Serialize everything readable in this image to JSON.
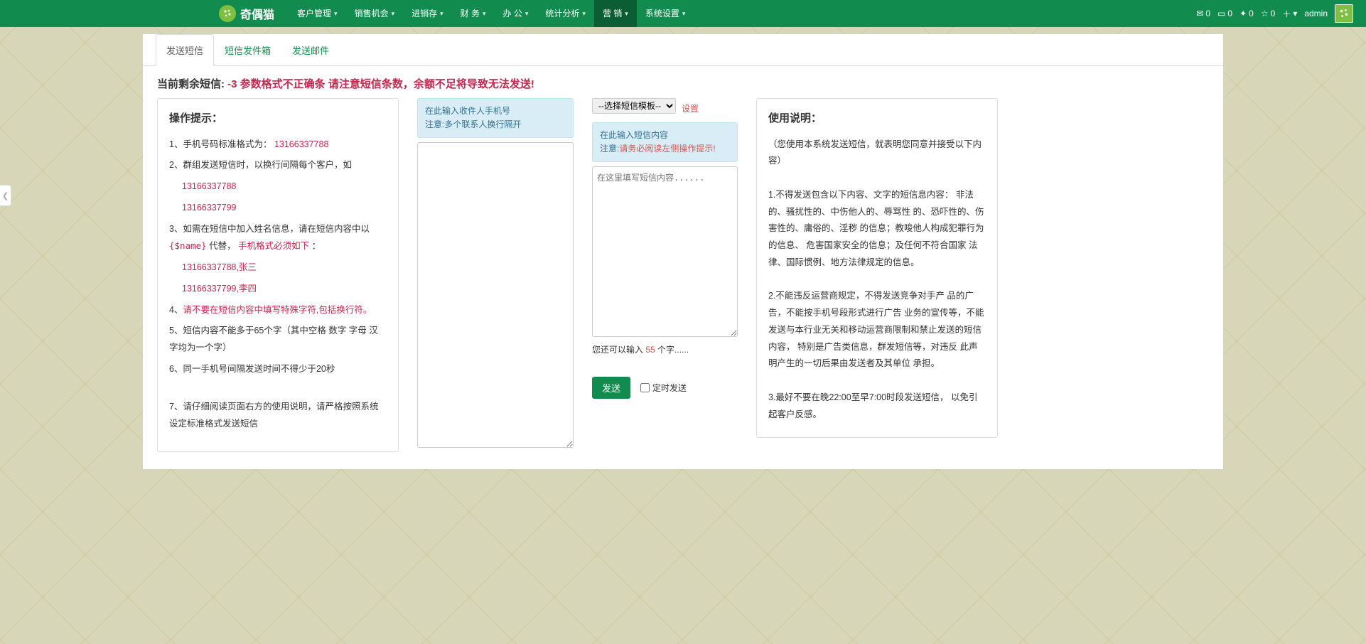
{
  "brand": {
    "name": "奇偶猫"
  },
  "nav": {
    "items": [
      {
        "label": "客户管理"
      },
      {
        "label": "销售机会"
      },
      {
        "label": "进销存"
      },
      {
        "label": "财 务"
      },
      {
        "label": "办 公"
      },
      {
        "label": "统计分析"
      },
      {
        "label": "营 销",
        "active": true
      },
      {
        "label": "系统设置"
      }
    ]
  },
  "navright": {
    "mail_count": "0",
    "card_count": "0",
    "gear_count": "0",
    "star_count": "0",
    "username": "admin"
  },
  "tabs": {
    "t1": "发送短信",
    "t2": "短信发件箱",
    "t3": "发送邮件"
  },
  "alert": {
    "prefix": "当前剩余短信:",
    "red": " -3 参数格式不正确条 请注意短信条数，余额不足将导致无法发送!"
  },
  "tips": {
    "title": "操作提示：",
    "l1a": "1、手机号码标准格式为：  ",
    "l1b": "13166337788",
    "l2": "2、群组发送短信时，以换行间隔每个客户，如",
    "ex1": "13166337788",
    "ex2": "13166337799",
    "l3a": "3、如需在短信中加入姓名信息，请在短信内容中以 ",
    "l3code": "{$name}",
    "l3b": "代替，",
    "l3c": "手机格式必须如下",
    "l3d": " ：",
    "ex3": "13166337788,张三",
    "ex4": "13166337799,李四",
    "l4": "4、",
    "l4red": "请不要在短信内容中填写特殊字符,包括换行符。",
    "l5": "5、短信内容不能多于65个字（其中空格  数字  字母  汉字均为一个字）",
    "l6": "6、同一手机号间隔发送时间不得少于20秒",
    "l7": "7、请仔细阅读页面右方的使用说明，请严格按照系统设定标准格式发送短信"
  },
  "phonehint": {
    "line1": "在此输入收件人手机号",
    "line2": "注意:多个联系人换行隔开"
  },
  "tpl": {
    "selected": "--选择短信模板--",
    "set": "设置"
  },
  "contenthint": {
    "line1": "在此输入短信内容",
    "line2a": "注意:",
    "line2b": "请务必阅读左侧操作提示!"
  },
  "content_placeholder": "在这里填写短信内容......",
  "count": {
    "prefix": "您还可以输入 ",
    "num": "55",
    "suffix": " 个字......"
  },
  "send_btn": "发送",
  "timed_label": "定时发送",
  "usage": {
    "title": "使用说明：",
    "intro": "（您使用本系统发送短信，就表明您同意并接受以下内容）",
    "p1": "1.不得发送包含以下内容、文字的短信息内容：  非法的、骚扰性的、中伤他人的、辱骂性  的、恐吓性的、伤害性的、庸俗的、淫秽  的信息；教唆他人构成犯罪行为的信息、 危害国家安全的信息；及任何不符合国家 法律、国际惯例、地方法律规定的信息。",
    "p2": "2.不能违反运营商规定，不得发送竞争对手产  品的广告，不能按手机号段形式进行广告  业务的宣传等，不能发送与本行业无关和移动运营商限制和禁止发送的短信内容，  特别是广告类信息，群发短信等，对违反  此声明产生的一切后果由发送者及其单位 承担。",
    "p3": "3.最好不要在晚22:00至早7:00时段发送短信，  以免引起客户反感。"
  }
}
